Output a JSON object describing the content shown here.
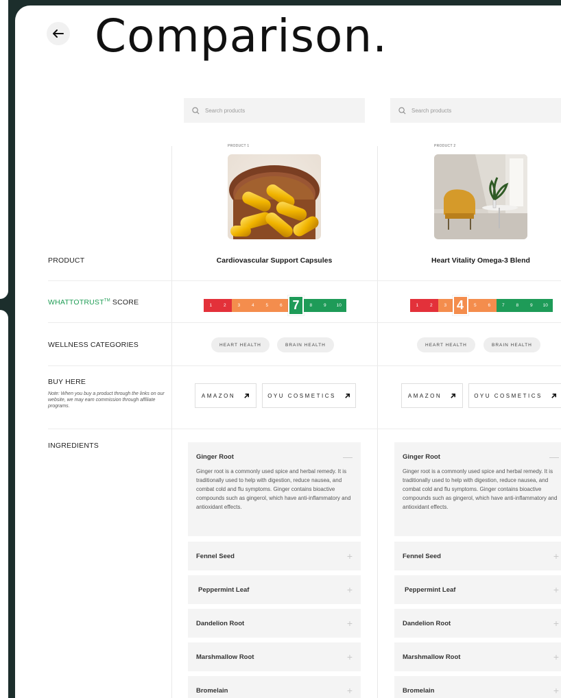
{
  "title": "Comparison.",
  "search_placeholder": "Search products",
  "row_labels": {
    "product": "PRODUCT",
    "score_brand": "WHATTOTRUST",
    "score_tm": "TM",
    "score_suffix": " SCORE",
    "wellness": "WELLNESS CATEGORIES",
    "buy": "BUY HERE",
    "buy_note": "Note: When you buy a product through the links on our website, we may earn commission through affiliate programs.",
    "ingredients": "INGREDIENTS"
  },
  "score_scale": [
    "1",
    "2",
    "3",
    "4",
    "5",
    "6",
    "7",
    "8",
    "9",
    "10"
  ],
  "colors": {
    "red": "#e3313a",
    "orange": "#f48d4d",
    "green": "#1e9b58",
    "brand_green": "#1f9d55"
  },
  "products": [
    {
      "label": "PRODUCT 1",
      "name": "Cardiovascular Support Capsules",
      "image_icon": "capsules-photo",
      "score": 7,
      "categories": [
        "HEART HEALTH",
        "BRAIN HEALTH"
      ],
      "buy": [
        "AMAZON",
        "OYU COSMETICS"
      ],
      "ingredients": [
        {
          "name": "Ginger Root",
          "expanded": true,
          "desc": "Ginger root is a commonly used spice and herbal remedy. It is traditionally used to help with digestion, reduce nausea, and combat cold and flu symptoms. Ginger contains bioactive compounds such as gingerol, which have anti-inflammatory and antioxidant effects."
        },
        {
          "name": "Fennel Seed"
        },
        {
          "name": "Peppermint Leaf"
        },
        {
          "name": "Dandelion Root"
        },
        {
          "name": "Marshmallow Root"
        },
        {
          "name": "Bromelain"
        }
      ]
    },
    {
      "label": "PRODUCT 2",
      "name": "Heart Vitality Omega-3 Blend",
      "image_icon": "interior-photo",
      "score": 4,
      "categories": [
        "HEART HEALTH",
        "BRAIN HEALTH"
      ],
      "buy": [
        "AMAZON",
        "OYU COSMETICS"
      ],
      "ingredients": [
        {
          "name": "Ginger Root",
          "expanded": true,
          "desc": "Ginger root is a commonly used spice and herbal remedy. It is traditionally used to help with digestion, reduce nausea, and combat cold and flu symptoms. Ginger contains bioactive compounds such as gingerol, which have anti-inflammatory and antioxidant effects."
        },
        {
          "name": "Fennel Seed"
        },
        {
          "name": "Peppermint Leaf"
        },
        {
          "name": "Dandelion Root"
        },
        {
          "name": "Marshmallow Root"
        },
        {
          "name": "Bromelain"
        }
      ]
    }
  ]
}
